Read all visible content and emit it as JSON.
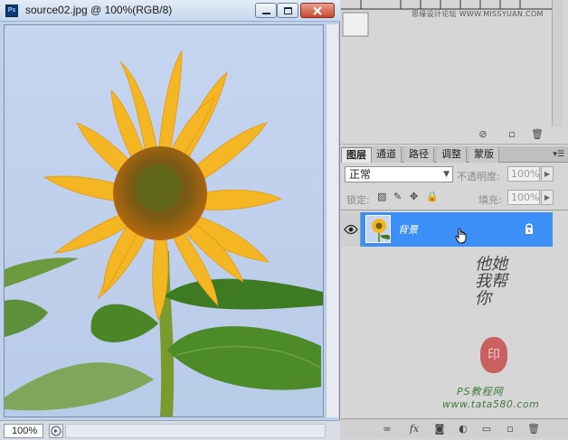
{
  "document": {
    "title": "source02.jpg @ 100%(RGB/8)",
    "app_icon_label": "Ps",
    "zoom": "100%"
  },
  "swatches_panel": {
    "watermark": "思缘设计论坛 WWW.MISSYUAN.COM"
  },
  "layers_panel": {
    "tabs": [
      "图层",
      "通道",
      "路径",
      "调整",
      "蒙版"
    ],
    "active_tab": "图层",
    "blend_mode": "正常",
    "opacity_label": "不透明度:",
    "opacity_value": "100%",
    "lock_label": "锁定:",
    "fill_label": "填充:",
    "fill_value": "100%",
    "layers": [
      {
        "name": "背景",
        "visible": true,
        "selected": true,
        "locked": true
      }
    ]
  },
  "watermark": {
    "calligraphy": "他她我帮你",
    "stamp": "印",
    "site_line1": "PS教程网",
    "site_line2": "www.tata580.com"
  },
  "colors": {
    "selected_layer": "#3b8ff6",
    "titlebar": "#c6d7ee",
    "close_button": "#c64a2f"
  }
}
